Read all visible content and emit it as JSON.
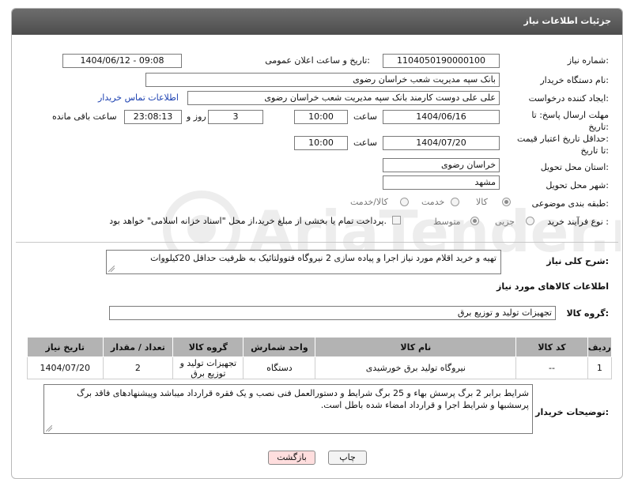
{
  "window_title": "جزئیات اطلاعات نیاز",
  "fields": {
    "need_number_label": "شماره نیاز:",
    "need_number": "1104050190000100",
    "announce_label": "تاریخ و ساعت اعلان عمومی:",
    "announce_value": "1404/06/12 - 09:08",
    "buyer_org_label": "نام دستگاه خریدار:",
    "buyer_org": "بانک سپه مدیریت شعب خراسان رضوی",
    "creator_label": "ایجاد کننده درخواست:",
    "creator": "علی علی دوست کارمند بانک سپه مدیریت شعب خراسان رضوی",
    "contact_link": "اطلاعات تماس خریدار",
    "deadline_label_1": "مهلت ارسال پاسخ: تا",
    "deadline_label_2": "تاریخ:",
    "deadline_date": "1404/06/16",
    "time_label": "ساعت",
    "deadline_time": "10:00",
    "days_value": "3",
    "days_label": "روز و",
    "remaining_time": "23:08:13",
    "remaining_label": "ساعت باقی مانده",
    "price_label_1": "حداقل تاریخ اعتبار قیمت:",
    "price_label_2": "تا تاریخ:",
    "price_date": "1404/07/20",
    "price_time": "10:00",
    "province_label": "استان محل تحویل:",
    "province": "خراسان رضوی",
    "city_label": "شهر محل تحویل:",
    "city": "مشهد",
    "category_label": "طبقه بندی موضوعی:",
    "category_options": [
      "کالا",
      "خدمت",
      "کالا/خدمت"
    ],
    "process_label": "نوع فرآیند خرید :",
    "process_options": [
      "جزیی",
      "متوسط"
    ],
    "payment_note": "پرداخت تمام یا بخشی از مبلغ خرید،از محل \"اسناد خزانه اسلامی\" خواهد بود."
  },
  "summary": {
    "label": "شرح کلی نیاز:",
    "text": "تهیه و خرید اقلام مورد نیاز اجرا و پیاده سازی 2 نیروگاه فتوولتائیک به ظرفیت حداقل 20کیلووات"
  },
  "goods_section": {
    "title": "اطلاعات کالاهای مورد نیاز",
    "group_label": "گروه کالا:",
    "group_value": "تجهیزات تولید و توزیع برق"
  },
  "table": {
    "headers": [
      "ردیف",
      "کد کالا",
      "نام کالا",
      "واحد شمارش",
      "گروه کالا",
      "تعداد / مقدار",
      "تاریخ نیاز"
    ],
    "rows": [
      [
        "1",
        "--",
        "نیروگاه تولید برق خورشیدی",
        "دستگاه",
        "تجهیزات تولید و توزیع برق",
        "2",
        "1404/07/20"
      ]
    ]
  },
  "buyer_notes": {
    "label": "توضیحات خریدار:",
    "text": "شرایط برابر 2 برگ پرسش بهاء و 25 برگ شرایط و دستورالعمل فنی نصب و یک فقره قرارداد میباشد وپیشنهادهای فاقد برگ پرسشبها و شرایط اجرا و قرارداد امضاء شده باطل است."
  },
  "buttons": {
    "print": "چاپ",
    "back": "بازگشت"
  },
  "watermark": "AriaTender.net",
  "colors": {
    "link": "#1a3fb0",
    "header": "#5a5a5a",
    "back_button": "#ffdede"
  }
}
